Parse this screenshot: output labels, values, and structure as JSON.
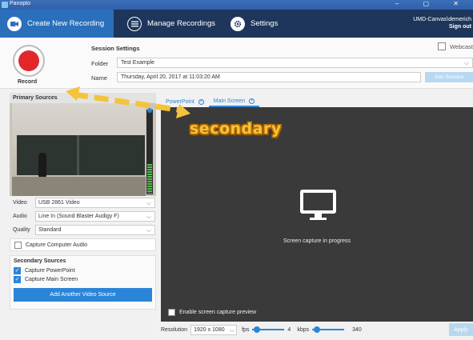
{
  "window": {
    "title": "Panopto",
    "controls": "–  ▢  ✕"
  },
  "header": {
    "nav": [
      {
        "label": "Create New Recording",
        "icon": "camera-icon"
      },
      {
        "label": "Manage Recordings",
        "icon": "list-icon"
      },
      {
        "label": "Settings",
        "icon": "gear-icon"
      }
    ],
    "user": "UMD-Canvas\\demerich",
    "signout": "Sign out"
  },
  "record": {
    "label": "Record"
  },
  "session": {
    "title": "Session Settings",
    "webcast_label": "Webcast",
    "folder_label": "Folder",
    "folder_value": "Test Example",
    "name_label": "Name",
    "name_value": "Thursday, April 20, 2017 at 11:03:20 AM",
    "join_label": "Join Session"
  },
  "primary": {
    "title": "Primary Sources",
    "video_label": "Video",
    "video_value": "USB 2861 Video",
    "audio_label": "Audio",
    "audio_value": "Line In (Sound Blaster Audigy F)",
    "quality_label": "Quality",
    "quality_value": "Standard",
    "capture_audio_label": "Capture Computer Audio",
    "audio_level": 0.36
  },
  "secondary": {
    "title": "Secondary Sources",
    "items": [
      {
        "label": "Capture PowerPoint",
        "checked": true
      },
      {
        "label": "Capture Main Screen",
        "checked": true
      }
    ],
    "add_label": "Add Another Video Source"
  },
  "tabs": [
    {
      "label": "PowerPoint",
      "active": false
    },
    {
      "label": "Main Screen",
      "active": true
    }
  ],
  "screen": {
    "status": "Screen capture in progress",
    "preview_label": "Enable screen capture preview"
  },
  "bottom": {
    "resolution_label": "Resolution",
    "resolution_value": "1920 x 1080",
    "fps_label": "fps",
    "fps_value": "4",
    "kbps_label": "kbps",
    "kbps_value": "340",
    "apply_label": "Apply"
  },
  "annotation": {
    "text": "secondary",
    "color": "#f5c33b"
  },
  "colors": {
    "accent": "#2a85d8",
    "header": "#1e365b",
    "record": "#e3262c"
  }
}
